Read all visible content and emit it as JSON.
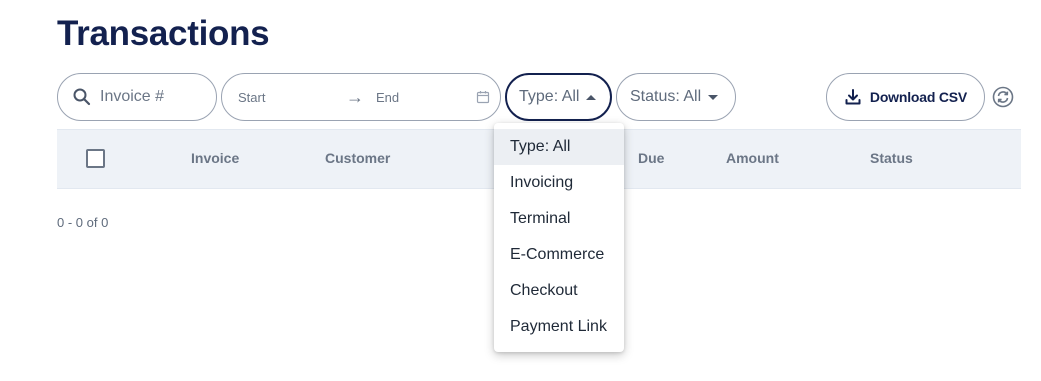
{
  "page": {
    "title": "Transactions"
  },
  "filters": {
    "search_placeholder": "Invoice #",
    "date_start_placeholder": "Start",
    "date_arrow": "→",
    "date_end_placeholder": "End",
    "type_label": "Type: All",
    "status_label": "Status: All",
    "download_label": "Download CSV"
  },
  "table": {
    "columns": [
      "Invoice",
      "Customer",
      "Due",
      "Amount",
      "Status"
    ]
  },
  "pagination": {
    "summary": "0 - 0 of 0"
  },
  "type_menu": {
    "options": [
      "Type: All",
      "Invoicing",
      "Terminal",
      "E-Commerce",
      "Checkout",
      "Payment Link"
    ],
    "selected": "Type: All"
  },
  "colors": {
    "brand": "#13214f",
    "header_bg": "#eef2f7",
    "border": "#9aa3b2"
  }
}
